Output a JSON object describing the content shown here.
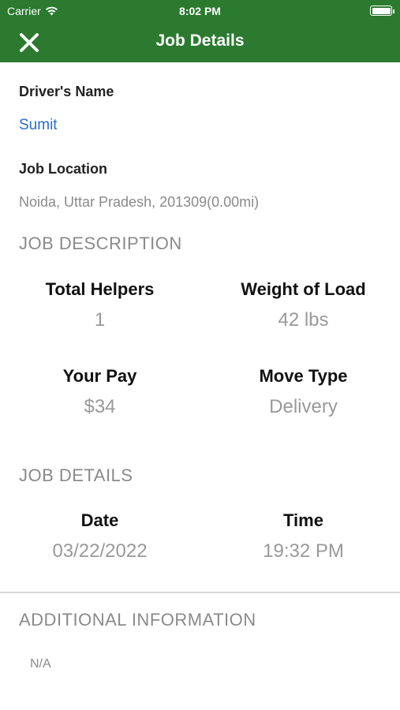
{
  "status": {
    "carrier": "Carrier",
    "time": "8:02 PM",
    "wifi_icon": "wifi-icon",
    "battery_icon": "battery-icon"
  },
  "nav": {
    "title": "Job Details",
    "close_icon": "close-icon"
  },
  "driver": {
    "label": "Driver's Name",
    "name": "Sumit"
  },
  "location": {
    "label": "Job Location",
    "value": "Noida, Uttar Pradesh, 201309(0.00mi)"
  },
  "job_description": {
    "header": "JOB DESCRIPTION",
    "total_helpers_label": "Total Helpers",
    "total_helpers_value": "1",
    "weight_label": "Weight of Load",
    "weight_value": "42 lbs",
    "pay_label": "Your Pay",
    "pay_value": "$34",
    "move_type_label": "Move Type",
    "move_type_value": "Delivery"
  },
  "job_details": {
    "header": "JOB DETAILS",
    "date_label": "Date",
    "date_value": "03/22/2022",
    "time_label": "Time",
    "time_value": "19:32 PM"
  },
  "additional": {
    "header": "ADDITIONAL INFORMATION",
    "value": "N/A"
  },
  "colors": {
    "nav_green": "#2b7a2f",
    "link_blue": "#2a6bd0",
    "muted_gray": "#8a8a8a"
  }
}
